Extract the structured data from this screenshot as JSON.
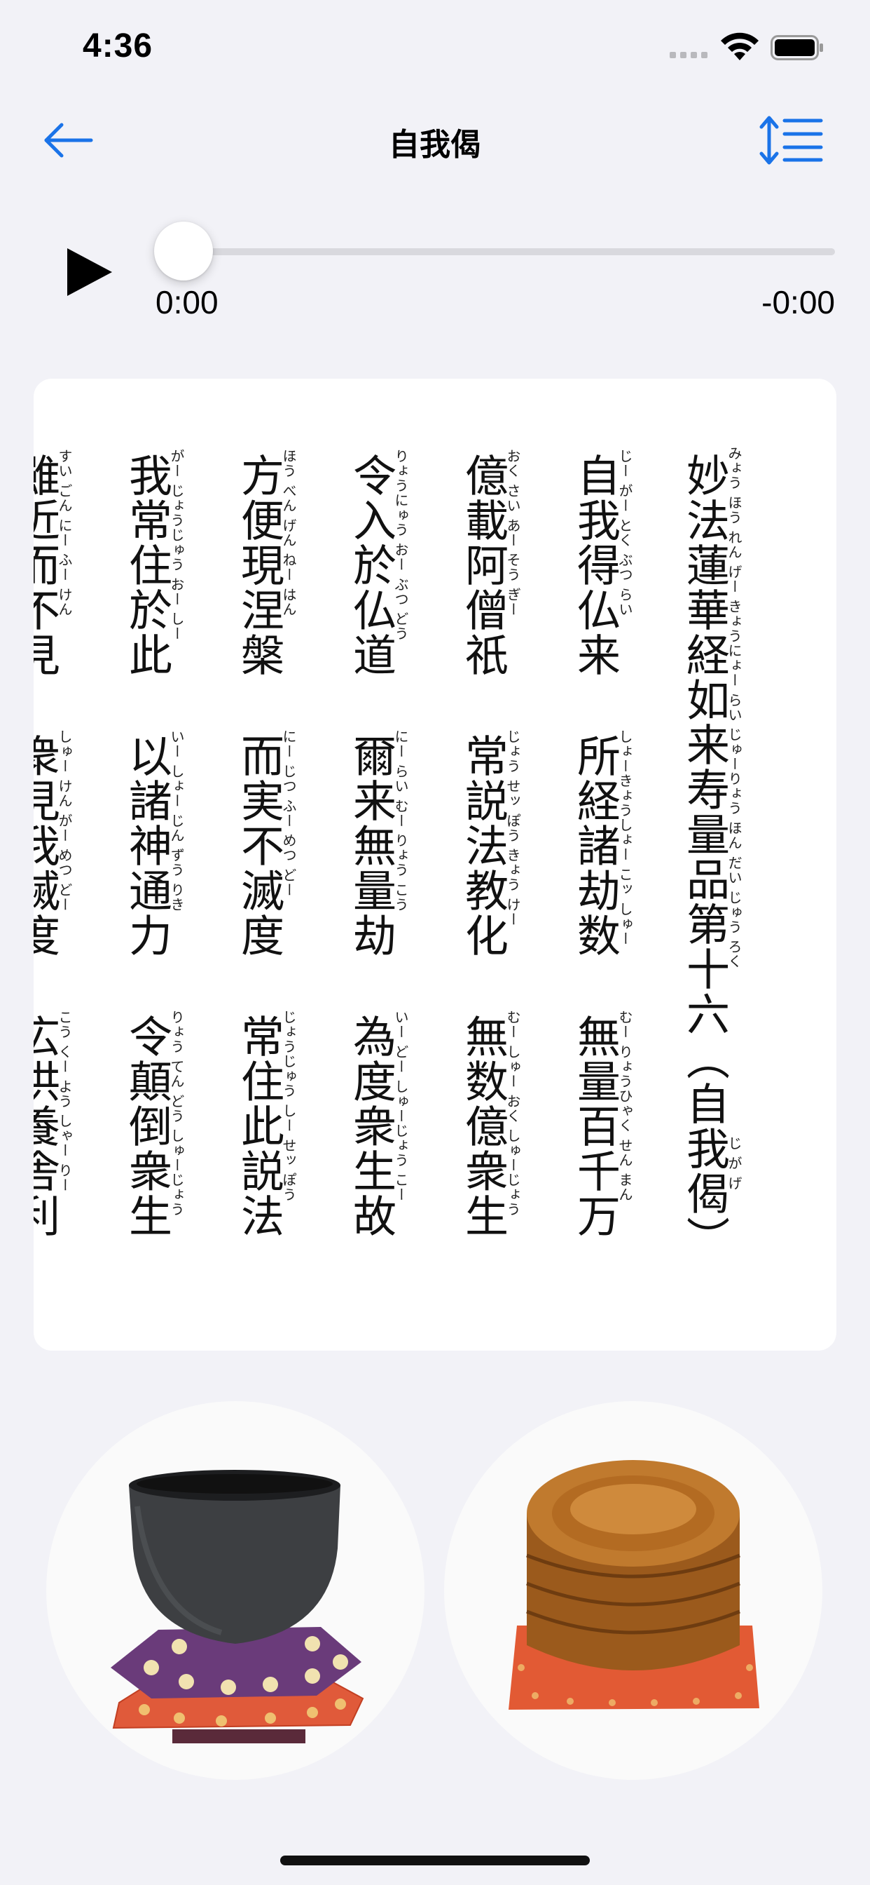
{
  "status_bar": {
    "time": "4:36"
  },
  "header": {
    "title": "自我偈"
  },
  "player": {
    "current_time": "0:00",
    "remaining_time": "-0:00",
    "progress": 0
  },
  "sutra": {
    "title_line": "妙法蓮華経如来寿量品第十六（自我偈）",
    "title_ruby": "みょう ほう れん げー きょうにょー らい じゅーりょう ほん だい じゅう ろく",
    "title_ruby_paren": "じ が げ",
    "columns": [
      {
        "stanzas": [
          "自我得仏来",
          "所経諸劫数",
          "無量百千万"
        ],
        "ruby": [
          "じー がー とく ぶつ らい",
          "しょーきょうしょー こッ しゅー",
          "むー りょうひゃく せん まん"
        ]
      },
      {
        "stanzas": [
          "億載阿僧祇",
          "常説法教化",
          "無数億衆生"
        ],
        "ruby": [
          "おく さい あー そう ぎー",
          "じょう せッ ぽう きょう けー",
          "むー しゅー おく しゅーじょう"
        ]
      },
      {
        "stanzas": [
          "令入於仏道",
          "爾来無量劫",
          "為度衆生故"
        ],
        "ruby": [
          "りょうにゅう おー ぶつ どう",
          "にー らい むー りょう こう",
          "いー どー しゅーじょう こー"
        ]
      },
      {
        "stanzas": [
          "方便現涅槃",
          "而実不滅度",
          "常住此説法"
        ],
        "ruby": [
          "ほう べん げん ねー はん",
          "にー じつ ふー めつ どー",
          "じょうじゅう しー せッ ぽう"
        ]
      },
      {
        "stanzas": [
          "我常住於此",
          "以諸神通力",
          "令顛倒衆生"
        ],
        "ruby": [
          "がー じょうじゅう おー しー",
          "いー しょー じん ずう りき",
          "りょう てん どう しゅーじょう"
        ]
      },
      {
        "stanzas": [
          "雖近而不見",
          "衆見我滅度",
          "広供養舎利"
        ],
        "ruby": [
          "すい ごん にー ふー けん",
          "しゅー けん がー めつ どー",
          "こう くー よう しゃー りー"
        ]
      }
    ]
  },
  "instruments": [
    {
      "name": "Rin bowl"
    },
    {
      "name": "Mokugyo"
    }
  ]
}
